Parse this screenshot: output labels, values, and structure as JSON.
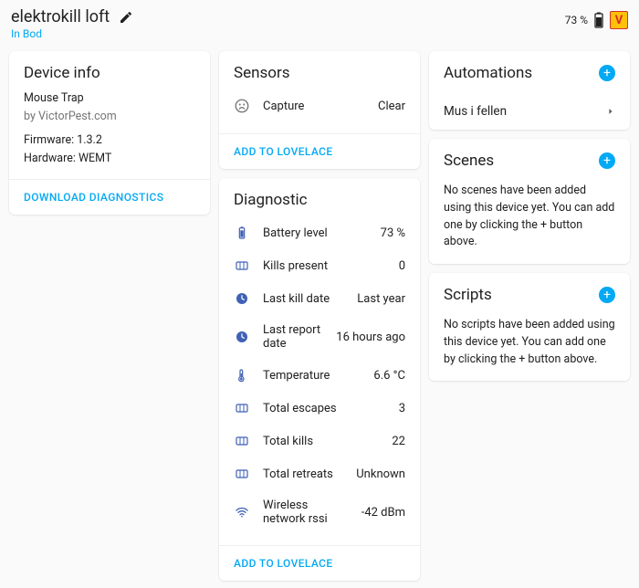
{
  "header": {
    "title": "elektrokill loft",
    "location": "In Bod",
    "battery_text": "73 %"
  },
  "device_info": {
    "title": "Device info",
    "model": "Mouse Trap",
    "manufacturer": "by VictorPest.com",
    "firmware": "Firmware: 1.3.2",
    "hardware": "Hardware: WEMT",
    "download": "DOWNLOAD DIAGNOSTICS"
  },
  "sensors": {
    "title": "Sensors",
    "capture_label": "Capture",
    "capture_value": "Clear",
    "action": "ADD TO LOVELACE"
  },
  "diagnostic": {
    "title": "Diagnostic",
    "rows": [
      {
        "icon": "battery",
        "label": "Battery level",
        "value": "73 %"
      },
      {
        "icon": "counter",
        "label": "Kills present",
        "value": "0"
      },
      {
        "icon": "clock",
        "label": "Last kill date",
        "value": "Last year"
      },
      {
        "icon": "clock",
        "label": "Last report date",
        "value": "16 hours ago"
      },
      {
        "icon": "thermo",
        "label": "Temperature",
        "value": "6.6 °C"
      },
      {
        "icon": "counter",
        "label": "Total escapes",
        "value": "3"
      },
      {
        "icon": "counter",
        "label": "Total kills",
        "value": "22"
      },
      {
        "icon": "counter",
        "label": "Total retreats",
        "value": "Unknown"
      },
      {
        "icon": "wifi",
        "label": "Wireless network rssi",
        "value": "-42 dBm"
      }
    ],
    "action": "ADD TO LOVELACE"
  },
  "automations": {
    "title": "Automations",
    "items": [
      {
        "label": "Mus i fellen"
      }
    ]
  },
  "scenes": {
    "title": "Scenes",
    "empty": "No scenes have been added using this device yet. You can add one by clicking the + button above."
  },
  "scripts": {
    "title": "Scripts",
    "empty": "No scripts have been added using this device yet. You can add one by clicking the + button above."
  }
}
